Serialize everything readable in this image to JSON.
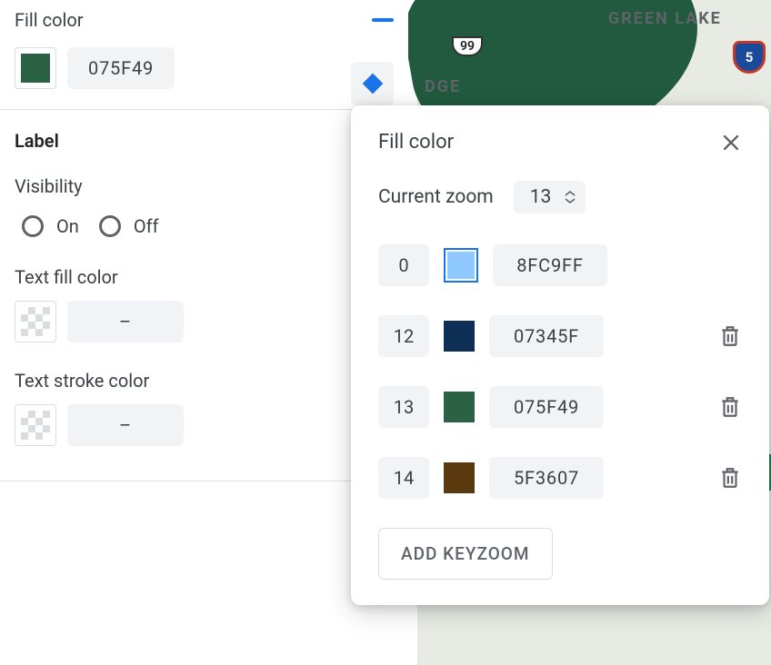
{
  "sidebar": {
    "fill_color_header": "Fill color",
    "fill_hex": "075F49",
    "fill_swatch_color": "#2b6145",
    "label_section": "Label",
    "visibility_label": "Visibility",
    "radio_on": "On",
    "radio_off": "Off",
    "text_fill_label": "Text fill color",
    "text_fill_value": "–",
    "text_stroke_label": "Text stroke color",
    "text_stroke_value": "–"
  },
  "map": {
    "label_greenlake": "GREEN LAKE",
    "label_dge": "DGE",
    "shield_99": "99",
    "shield_i5": "5"
  },
  "popover": {
    "title": "Fill color",
    "current_zoom_label": "Current zoom",
    "current_zoom_value": "13",
    "rows": [
      {
        "num": "0",
        "hex": "8FC9FF",
        "color": "#8fc9ff",
        "selected": true,
        "deletable": false
      },
      {
        "num": "12",
        "hex": "07345F",
        "color": "#0d2f55",
        "selected": false,
        "deletable": true
      },
      {
        "num": "13",
        "hex": "075F49",
        "color": "#2b6145",
        "selected": false,
        "deletable": true
      },
      {
        "num": "14",
        "hex": "5F3607",
        "color": "#5b390e",
        "selected": false,
        "deletable": true
      }
    ],
    "add_button": "ADD KEYZOOM"
  }
}
